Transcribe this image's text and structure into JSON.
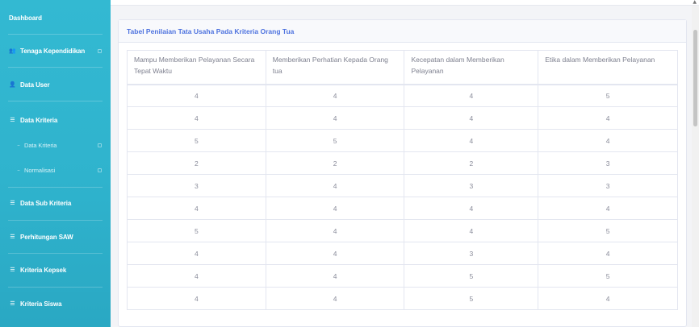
{
  "sidebar": {
    "items": [
      {
        "label": "Dashboard",
        "icon": "dashboard-icon",
        "glyph": "",
        "sub": false,
        "chev": false
      },
      {
        "label": "Tenaga Kependidikan",
        "icon": "users-icon",
        "glyph": "👥",
        "sub": false,
        "chev": true
      },
      {
        "label": "Data User",
        "icon": "user-icon",
        "glyph": "👤",
        "sub": false,
        "chev": false
      },
      {
        "label": "Data Kriteria",
        "icon": "list-icon",
        "glyph": "☰",
        "sub": false,
        "chev": false
      },
      {
        "label": "Data Kriteria",
        "icon": "dot-icon",
        "glyph": "–",
        "sub": true,
        "chev": true
      },
      {
        "label": "Normalisasi",
        "icon": "dot-icon",
        "glyph": "–",
        "sub": true,
        "chev": true
      },
      {
        "label": "Data Sub Kriteria",
        "icon": "list-icon",
        "glyph": "☰",
        "sub": false,
        "chev": false
      },
      {
        "label": "Perhitungan SAW",
        "icon": "list-icon",
        "glyph": "☰",
        "sub": false,
        "chev": false
      },
      {
        "label": "Kriteria Kepsek",
        "icon": "list-icon",
        "glyph": "☰",
        "sub": false,
        "chev": false
      },
      {
        "label": "Kriteria Siswa",
        "icon": "list-icon",
        "glyph": "☰",
        "sub": false,
        "chev": false
      }
    ]
  },
  "card": {
    "title": "Tabel Penilaian Tata Usaha Pada Kriteria Orang Tua"
  },
  "table": {
    "headers": [
      "Mampu Memberikan Pelayanan Secara Tepat Waktu",
      "Memberikan Perhatian Kepada Orang tua",
      "Kecepatan dalam Memberikan Pelayanan",
      "Etika dalam Memberikan Pelayanan"
    ],
    "rows": [
      [
        "4",
        "4",
        "4",
        "5"
      ],
      [
        "4",
        "4",
        "4",
        "4"
      ],
      [
        "5",
        "5",
        "4",
        "4"
      ],
      [
        "2",
        "2",
        "2",
        "3"
      ],
      [
        "3",
        "4",
        "3",
        "3"
      ],
      [
        "4",
        "4",
        "4",
        "4"
      ],
      [
        "5",
        "4",
        "4",
        "5"
      ],
      [
        "4",
        "4",
        "3",
        "4"
      ],
      [
        "4",
        "4",
        "5",
        "5"
      ],
      [
        "4",
        "4",
        "5",
        "4"
      ]
    ]
  },
  "window": {
    "scroll_up_glyph": "▲"
  }
}
